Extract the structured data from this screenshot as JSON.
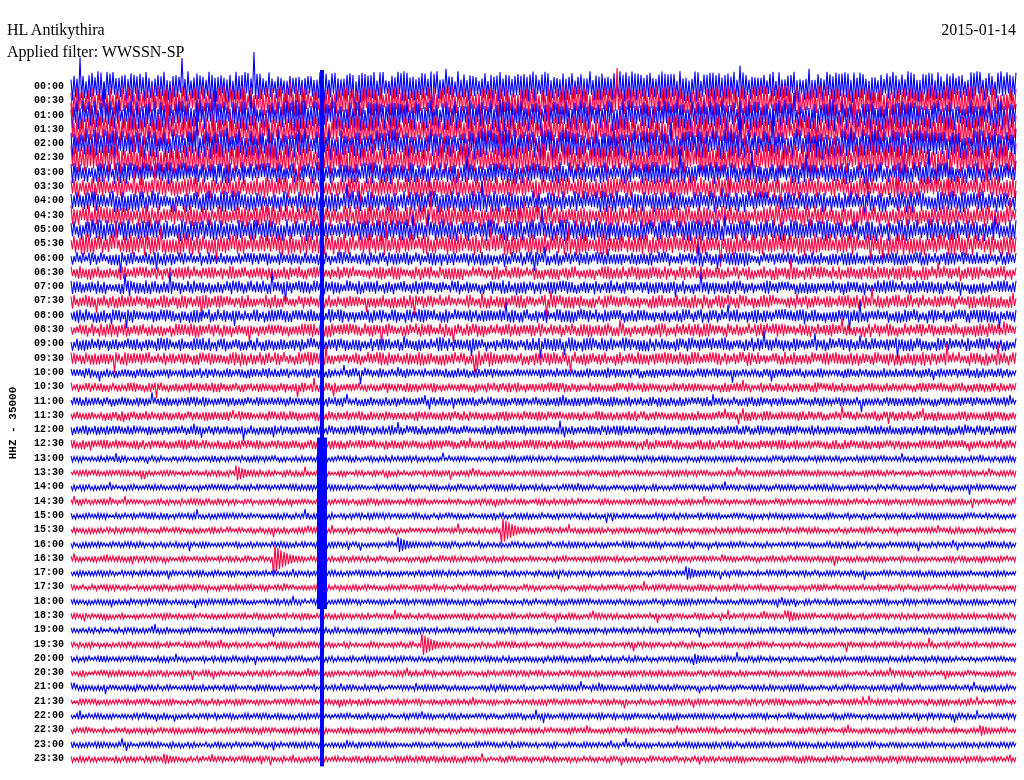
{
  "header": {
    "station": "HL Antikythira",
    "date": "2015-01-14",
    "filter": "Applied filter: WWSSN-SP"
  },
  "axis_label": "HHZ - 35000",
  "rows": [
    {
      "time": "00:00",
      "color": "#0000ff"
    },
    {
      "time": "00:30",
      "color": "#ff0040"
    },
    {
      "time": "01:00",
      "color": "#0000ff"
    },
    {
      "time": "01:30",
      "color": "#ff0040"
    },
    {
      "time": "02:00",
      "color": "#0000ff"
    },
    {
      "time": "02:30",
      "color": "#ff0040"
    },
    {
      "time": "03:00",
      "color": "#0000ff"
    },
    {
      "time": "03:30",
      "color": "#ff0040"
    },
    {
      "time": "04:00",
      "color": "#0000ff"
    },
    {
      "time": "04:30",
      "color": "#ff0040"
    },
    {
      "time": "05:00",
      "color": "#0000ff"
    },
    {
      "time": "05:30",
      "color": "#ff0040"
    },
    {
      "time": "06:00",
      "color": "#0000ff"
    },
    {
      "time": "06:30",
      "color": "#ff0040"
    },
    {
      "time": "07:00",
      "color": "#0000ff"
    },
    {
      "time": "07:30",
      "color": "#ff0040"
    },
    {
      "time": "08:00",
      "color": "#0000ff"
    },
    {
      "time": "08:30",
      "color": "#ff0040"
    },
    {
      "time": "09:00",
      "color": "#0000ff"
    },
    {
      "time": "09:30",
      "color": "#ff0040"
    },
    {
      "time": "10:00",
      "color": "#0000ff"
    },
    {
      "time": "10:30",
      "color": "#ff0040"
    },
    {
      "time": "11:00",
      "color": "#0000ff"
    },
    {
      "time": "11:30",
      "color": "#ff0040"
    },
    {
      "time": "12:00",
      "color": "#0000ff"
    },
    {
      "time": "12:30",
      "color": "#ff0040"
    },
    {
      "time": "13:00",
      "color": "#0000ff"
    },
    {
      "time": "13:30",
      "color": "#ff0040"
    },
    {
      "time": "14:00",
      "color": "#0000ff"
    },
    {
      "time": "14:30",
      "color": "#ff0040"
    },
    {
      "time": "15:00",
      "color": "#0000ff"
    },
    {
      "time": "15:30",
      "color": "#ff0040"
    },
    {
      "time": "16:00",
      "color": "#0000ff"
    },
    {
      "time": "16:30",
      "color": "#ff0040"
    },
    {
      "time": "17:00",
      "color": "#0000ff"
    },
    {
      "time": "17:30",
      "color": "#ff0040"
    },
    {
      "time": "18:00",
      "color": "#0000ff"
    },
    {
      "time": "18:30",
      "color": "#ff0040"
    },
    {
      "time": "19:00",
      "color": "#0000ff"
    },
    {
      "time": "19:30",
      "color": "#ff0040"
    },
    {
      "time": "20:00",
      "color": "#0000ff"
    },
    {
      "time": "20:30",
      "color": "#ff0040"
    },
    {
      "time": "21:00",
      "color": "#0000ff"
    },
    {
      "time": "21:30",
      "color": "#ff0040"
    },
    {
      "time": "22:00",
      "color": "#0000ff"
    },
    {
      "time": "22:30",
      "color": "#ff0040"
    },
    {
      "time": "23:00",
      "color": "#0000ff"
    },
    {
      "time": "23:30",
      "color": "#ff0040"
    }
  ]
}
